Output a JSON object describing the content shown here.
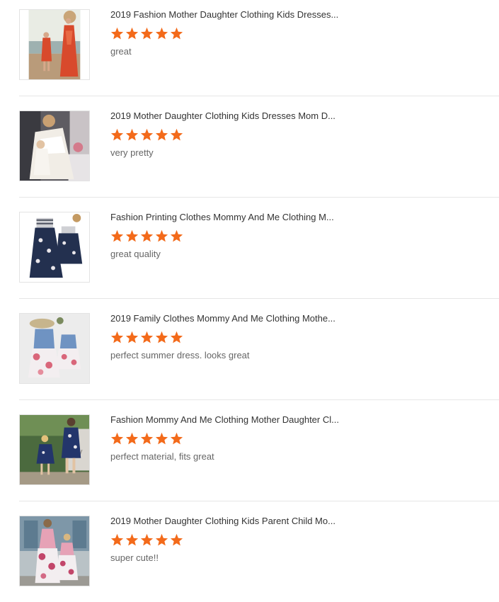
{
  "star_color": "#f36a1a",
  "reviews": [
    {
      "title": "2019 Fashion Mother Daughter Clothing Kids Dresses...",
      "rating": 5,
      "rating_max": 5,
      "comment": "great",
      "thumbnail": "mother-daughter-beach-photo"
    },
    {
      "title": "2019 Mother Daughter Clothing Kids Dresses Mom D...",
      "rating": 5,
      "rating_max": 5,
      "comment": "very pretty",
      "thumbnail": "white-lace-dress-photo"
    },
    {
      "title": "Fashion Printing Clothes Mommy And Me Clothing M...",
      "rating": 5,
      "rating_max": 5,
      "comment": "great quality",
      "thumbnail": "navy-floral-dress-pair-photo"
    },
    {
      "title": "2019 Family Clothes Mommy And Me Clothing Mothe...",
      "rating": 5,
      "rating_max": 5,
      "comment": "perfect summer dress. looks great",
      "thumbnail": "denim-floral-dress-pair-photo"
    },
    {
      "title": "Fashion Mommy And Me Clothing Mother Daughter Cl...",
      "rating": 5,
      "rating_max": 5,
      "comment": "perfect material, fits great",
      "thumbnail": "mother-daughter-navy-dress-photo"
    },
    {
      "title": "2019 Mother Daughter Clothing Kids Parent Child Mo...",
      "rating": 5,
      "rating_max": 5,
      "comment": "super cute!!",
      "thumbnail": "mother-daughter-maxi-dress-photo"
    }
  ]
}
